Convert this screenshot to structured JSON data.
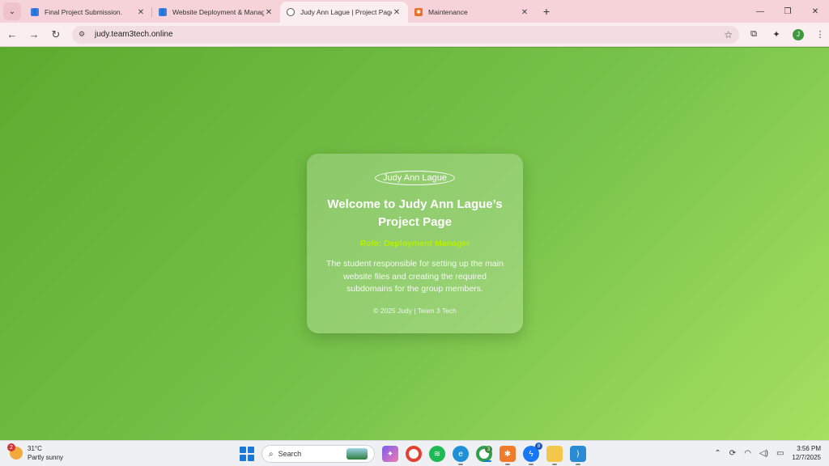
{
  "browser": {
    "tabs": [
      {
        "title": "Final Project Submission.",
        "icon": "classroom-icon",
        "active": false
      },
      {
        "title": "Website Deployment & Manag",
        "icon": "classroom-icon",
        "active": false
      },
      {
        "title": "Judy Ann Lague | Project Page",
        "icon": "globe-icon",
        "active": true
      },
      {
        "title": "Maintenance",
        "icon": "xampp-icon",
        "active": false
      }
    ],
    "url": "judy.team3tech.online",
    "profile_initial": "J"
  },
  "card": {
    "logo_text": "Judy Ann Lague",
    "heading": "Welcome to Judy Ann Lague’s Project Page",
    "role": "Role: Deployment Manager",
    "description": "The student responsible for setting up the main website files and creating the required subdomains for the group members.",
    "footer": "© 2025 Judy | Team 3 Tech"
  },
  "taskbar": {
    "weather_temp": "31°C",
    "weather_desc": "Partly sunny",
    "weather_badge": "2",
    "search_label": "Search",
    "chrome_badge": "3",
    "messenger_badge": "8",
    "time": "3:56 PM",
    "date": "12/7/2025"
  },
  "colors": {
    "page_gradient_start": "#5cab2f",
    "page_gradient_end": "#a6e060",
    "role_accent": "#b6f000",
    "tabbar": "#f6d2d9"
  }
}
